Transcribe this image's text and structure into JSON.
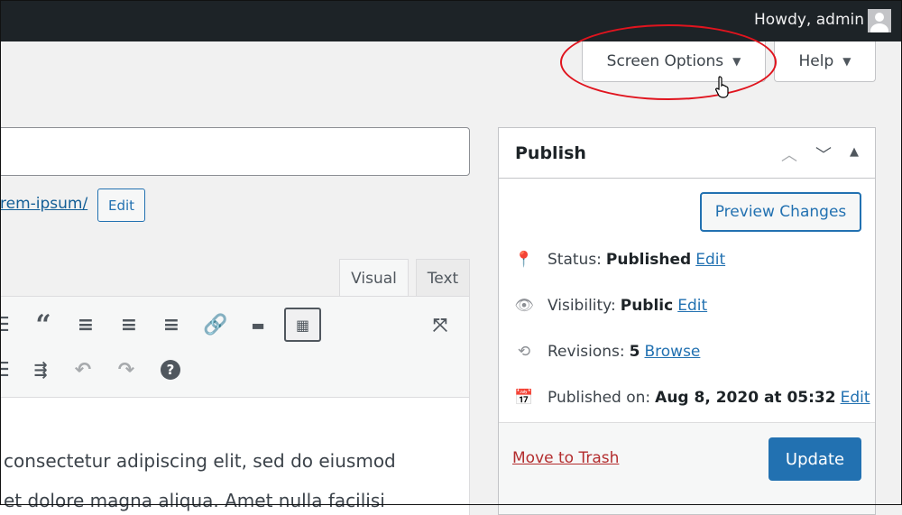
{
  "adminbar": {
    "greeting": "Howdy, admin"
  },
  "screen_options": {
    "label": "Screen Options",
    "help_label": "Help"
  },
  "permalink": {
    "slug": "rem-ipsum/",
    "edit_label": "Edit"
  },
  "editor": {
    "tabs": [
      {
        "label": "Visual",
        "active": true
      },
      {
        "label": "Text",
        "active": false
      }
    ],
    "content_lines": [
      "consectetur adipiscing elit, sed do eiusmod",
      "et dolore magna aliqua. Amet nulla facilisi"
    ]
  },
  "publish": {
    "title": "Publish",
    "preview_label": "Preview Changes",
    "status_label": "Status:",
    "status_value": "Published",
    "status_edit": "Edit",
    "visibility_label": "Visibility:",
    "visibility_value": "Public",
    "visibility_edit": "Edit",
    "revisions_label": "Revisions:",
    "revisions_value": "5",
    "revisions_browse": "Browse",
    "published_label": "Published on:",
    "published_value": "Aug 8, 2020 at 05:32",
    "published_edit": "Edit",
    "trash_label": "Move to Trash",
    "update_label": "Update"
  },
  "colors": {
    "accent": "#2271b1",
    "trash": "#b32d2e",
    "highlight": "#e0141e"
  }
}
